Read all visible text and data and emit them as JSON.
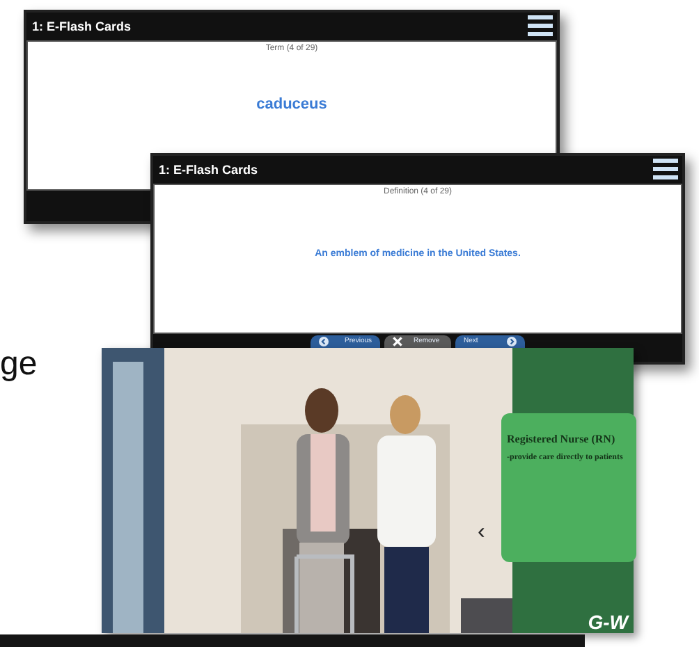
{
  "windows": [
    {
      "title": "1: E-Flash Cards",
      "label": "Term (4 of 29)",
      "content": "caduceus"
    },
    {
      "title": "1: E-Flash Cards",
      "label": "Definition (4 of 29)",
      "content": "An emblem of medicine in the United States.",
      "buttons": [
        {
          "label": "Previous",
          "kind": "prev"
        },
        {
          "label": "Remove",
          "kind": "remove"
        },
        {
          "label": "Next",
          "kind": "next"
        }
      ]
    }
  ],
  "side_text": "ge",
  "slide": {
    "kind": "picture",
    "card": {
      "title": "Registered Nurse (RN)",
      "body": "-provide care directly to patients"
    },
    "nav": "‹",
    "logo": "G-W"
  }
}
